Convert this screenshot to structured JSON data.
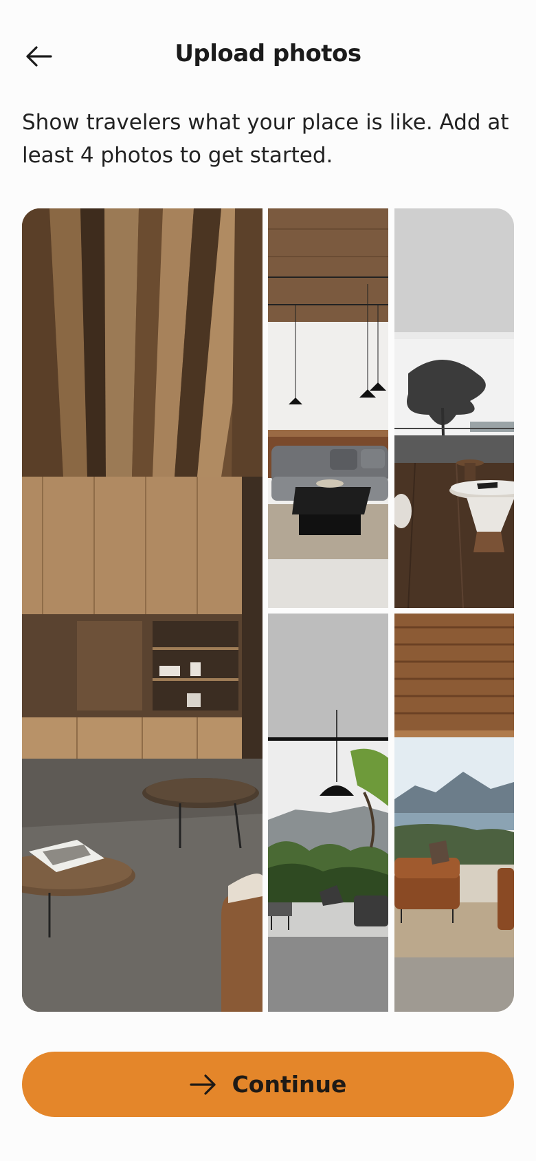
{
  "header": {
    "title": "Upload photos",
    "back_icon": "arrow-left-icon"
  },
  "intro": {
    "text": "Show travelers what your place is like. Add at least 4 photos to get started."
  },
  "gallery": {
    "photos": [
      {
        "name": "living-room-wood-ceiling"
      },
      {
        "name": "lounge-grey-sofa"
      },
      {
        "name": "terrace-tree-view"
      },
      {
        "name": "room-jungle-view"
      },
      {
        "name": "lounge-lake-view"
      }
    ]
  },
  "footer": {
    "continue_label": "Continue",
    "continue_icon": "arrow-right-icon",
    "accent_color": "#e4862a"
  }
}
